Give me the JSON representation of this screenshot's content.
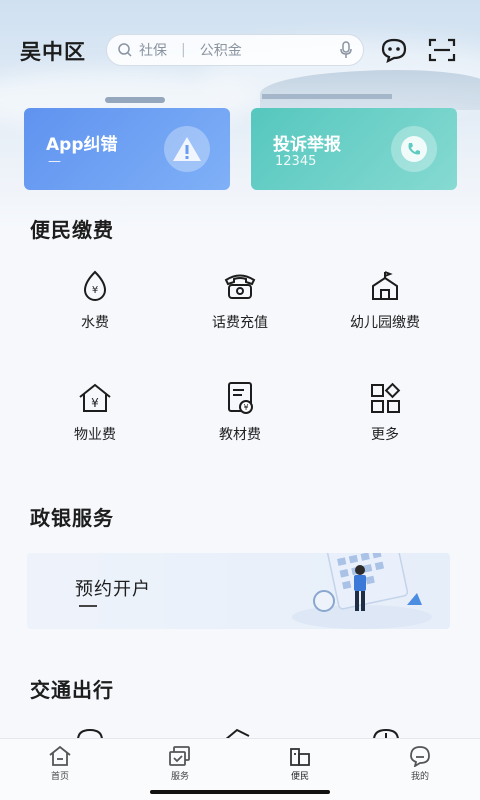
{
  "header": {
    "district": "吴中区",
    "search_hint_1": "社保",
    "search_sep": "|",
    "search_hint_2": "公积金"
  },
  "cards": [
    {
      "title": "App纠错",
      "subtitle": "—",
      "icon": "alert-triangle-icon",
      "color": "#6a9cf0"
    },
    {
      "title": "投诉举报",
      "subtitle": "12345",
      "icon": "phone-icon",
      "color": "#5fcbc2"
    }
  ],
  "sections": {
    "payment": {
      "title": "便民缴费",
      "items": [
        {
          "label": "水费",
          "icon": "water-drop-icon"
        },
        {
          "label": "话费充值",
          "icon": "telephone-icon"
        },
        {
          "label": "幼儿园缴费",
          "icon": "kindergarten-icon"
        },
        {
          "label": "物业费",
          "icon": "house-yuan-icon"
        },
        {
          "label": "教材费",
          "icon": "book-yuan-icon"
        },
        {
          "label": "更多",
          "icon": "more-grid-icon"
        }
      ]
    },
    "gov_bank": {
      "title": "政银服务",
      "banner_title": "预约开户",
      "banner_sub": "—"
    },
    "transport": {
      "title": "交通出行"
    }
  },
  "bottom_nav": [
    {
      "label": "首页",
      "icon": "home-icon"
    },
    {
      "label": "服务",
      "icon": "service-icon"
    },
    {
      "label": "便民",
      "icon": "convenience-icon",
      "active": true
    },
    {
      "label": "我的",
      "icon": "profile-icon"
    }
  ]
}
